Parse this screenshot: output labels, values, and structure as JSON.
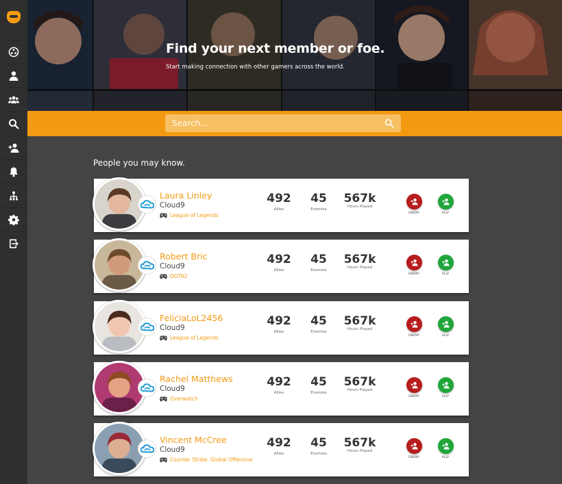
{
  "icons": {
    "logo": "gamepad-logo-icon",
    "nav": [
      "dashboard-icon",
      "user-icon",
      "group-icon",
      "search-icon",
      "add-user-icon",
      "bell-icon",
      "hierarchy-icon",
      "gear-icon",
      "sign-out-icon"
    ],
    "team": "cloud9-logo-icon",
    "game": "gamepad-icon",
    "enemy_button": "add-enemy-icon",
    "ally_button": "add-ally-icon"
  },
  "colors": {
    "accent": "#f39a12",
    "enemy": "#b81c1c",
    "ally": "#20a63a",
    "sidebar": "#2f2f2f",
    "background": "#444444"
  },
  "hero": {
    "title": "Find your next member or foe.",
    "subtitle": "Start making connection with other gamers across the world."
  },
  "search": {
    "placeholder": "Search..."
  },
  "section_title": "People you may know.",
  "stat_labels": {
    "allies": "Allies",
    "enemies": "Enemies",
    "hours": "Hours Played"
  },
  "action_labels": {
    "enemy": "ENEMY",
    "ally": "ALLY"
  },
  "people": [
    {
      "name": "Laura Linley",
      "team": "Cloud9",
      "game": "League of Legends",
      "allies": "492",
      "enemies": "45",
      "hours": "567k"
    },
    {
      "name": "Robert Bric",
      "team": "Cloud9",
      "game": "DOTA2",
      "allies": "492",
      "enemies": "45",
      "hours": "567k"
    },
    {
      "name": "FeliciaLoL2456",
      "team": "Cloud9",
      "game": "League of Legends",
      "allies": "492",
      "enemies": "45",
      "hours": "567k"
    },
    {
      "name": "Rachel Matthews",
      "team": "Cloud9",
      "game": "Overwatch",
      "allies": "492",
      "enemies": "45",
      "hours": "567k"
    },
    {
      "name": "Vincent McCree",
      "team": "Cloud9",
      "game": "Counter Strike: Global Offensive",
      "allies": "492",
      "enemies": "45",
      "hours": "567k"
    }
  ]
}
